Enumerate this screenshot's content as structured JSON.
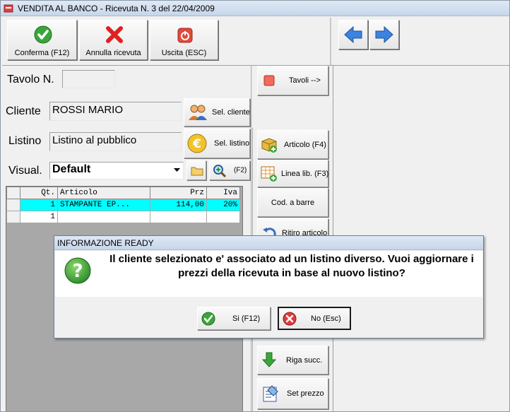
{
  "window": {
    "title": "VENDITA AL BANCO - Ricevuta N. 3 del 22/04/2009"
  },
  "toolbar": {
    "confirm_label": "Conferma (F12)",
    "cancel_label": "Annulla ricevuta",
    "exit_label": "Uscita (ESC)"
  },
  "form": {
    "tavolo_label": "Tavolo N.",
    "tavolo_value": "",
    "tavoli_button": "Tavoli -->",
    "cliente_label": "Cliente",
    "cliente_value": "ROSSI MARIO",
    "sel_cliente_button": "Sel. cliente",
    "listino_label": "Listino",
    "listino_value": "Listino al pubblico",
    "sel_listino_button": "Sel. listino",
    "visual_label": "Visual.",
    "visual_value": "Default",
    "f2_label": "(F2)"
  },
  "side_buttons": {
    "articolo": "Articolo (F4)",
    "linea_lib": "Linea lib. (F3)",
    "cod_barre": "Cod. a barre",
    "ritiro": "Ritiro articolo",
    "riga_succ": "Riga succ.",
    "set_prezzo": "Set prezzo"
  },
  "table": {
    "headers": {
      "qt": "Qt.",
      "articolo": "Articolo",
      "prz": "Prz",
      "iva": "Iva"
    },
    "rows": [
      {
        "qt": "1",
        "articolo": "STAMPANTE EP...",
        "prz": "114,00",
        "iva": "20%"
      },
      {
        "qt": "1",
        "articolo": "",
        "prz": "",
        "iva": ""
      }
    ]
  },
  "dialog": {
    "title": "INFORMAZIONE READY",
    "message": "Il cliente selezionato e' associato ad un listino diverso. Vuoi aggiornare i prezzi della ricevuta in base al nuovo listino?",
    "yes_label": "Si (F12)",
    "no_label": "No (Esc)"
  },
  "colors": {
    "selected_row": "#00ffff",
    "dialog_title": "#c6d6ea",
    "icon_green": "#3aa63a",
    "icon_red": "#e02020"
  }
}
